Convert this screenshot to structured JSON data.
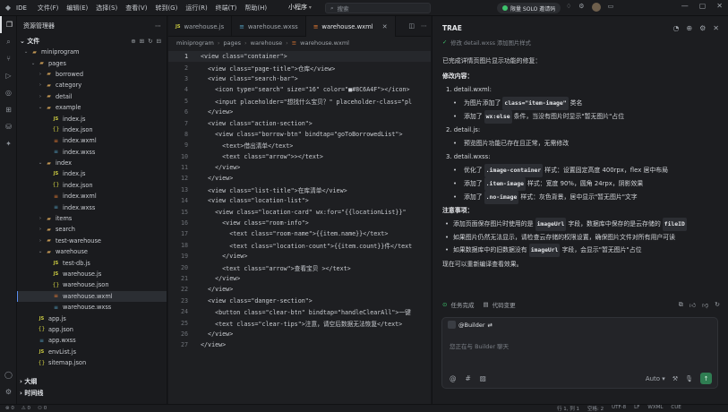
{
  "titlebar": {
    "ide": "IDE",
    "menu": [
      "文件(F)",
      "编辑(E)",
      "选择(S)",
      "查看(V)",
      "转到(G)",
      "运行(R)",
      "终端(T)",
      "帮助(H)"
    ],
    "project": "小程序",
    "search_placeholder": "搜索",
    "solo_label": "限量 SOLO 邀请码"
  },
  "explorer": {
    "title": "资源管理器",
    "section": "文件",
    "items": [
      {
        "label": "miniprogram",
        "depth": 0,
        "type": "folder",
        "open": true
      },
      {
        "label": "pages",
        "depth": 1,
        "type": "folder",
        "open": true
      },
      {
        "label": "borrowed",
        "depth": 2,
        "type": "folder",
        "open": false
      },
      {
        "label": "category",
        "depth": 2,
        "type": "folder",
        "open": false
      },
      {
        "label": "detail",
        "depth": 2,
        "type": "folder",
        "open": false
      },
      {
        "label": "example",
        "depth": 2,
        "type": "folder",
        "open": true
      },
      {
        "label": "index.js",
        "depth": 3,
        "type": "js"
      },
      {
        "label": "index.json",
        "depth": 3,
        "type": "json"
      },
      {
        "label": "index.wxml",
        "depth": 3,
        "type": "wxml"
      },
      {
        "label": "index.wxss",
        "depth": 3,
        "type": "wxss"
      },
      {
        "label": "index",
        "depth": 2,
        "type": "folder",
        "open": true
      },
      {
        "label": "index.js",
        "depth": 3,
        "type": "js"
      },
      {
        "label": "index.json",
        "depth": 3,
        "type": "json"
      },
      {
        "label": "index.wxml",
        "depth": 3,
        "type": "wxml"
      },
      {
        "label": "index.wxss",
        "depth": 3,
        "type": "wxss"
      },
      {
        "label": "items",
        "depth": 2,
        "type": "folder",
        "open": false
      },
      {
        "label": "search",
        "depth": 2,
        "type": "folder",
        "open": false
      },
      {
        "label": "test-warehouse",
        "depth": 2,
        "type": "folder",
        "open": false
      },
      {
        "label": "warehouse",
        "depth": 2,
        "type": "folder",
        "open": true
      },
      {
        "label": "test-db.js",
        "depth": 3,
        "type": "js"
      },
      {
        "label": "warehouse.js",
        "depth": 3,
        "type": "js"
      },
      {
        "label": "warehouse.json",
        "depth": 3,
        "type": "json"
      },
      {
        "label": "warehouse.wxml",
        "depth": 3,
        "type": "wxml",
        "selected": true
      },
      {
        "label": "warehouse.wxss",
        "depth": 3,
        "type": "wxss"
      },
      {
        "label": "app.js",
        "depth": 1,
        "type": "js"
      },
      {
        "label": "app.json",
        "depth": 1,
        "type": "json"
      },
      {
        "label": "app.wxss",
        "depth": 1,
        "type": "wxss"
      },
      {
        "label": "envList.js",
        "depth": 1,
        "type": "js"
      },
      {
        "label": "sitemap.json",
        "depth": 1,
        "type": "json"
      }
    ],
    "outline": "大纲",
    "timeline": "时间线"
  },
  "editor": {
    "tabs": [
      {
        "label": "warehouse.js",
        "type": "js",
        "active": false
      },
      {
        "label": "warehouse.wxss",
        "type": "wxss",
        "active": false
      },
      {
        "label": "warehouse.wxml",
        "type": "wxml",
        "active": true
      }
    ],
    "breadcrumb": [
      "miniprogram",
      "pages",
      "warehouse",
      "warehouse.wxml"
    ],
    "current_line": 1,
    "lines": [
      "<view class=\"container\">",
      "  <view class=\"page-title\">仓库</view>",
      "  <view class=\"search-bar\">",
      "    <icon type=\"search\" size=\"16\" color=\"■#8C6A4F\"></icon>",
      "    <input placeholder=\"想找什么宝贝？\" placeholder-class=\"pl",
      "  </view>",
      "  <view class=\"action-section\">",
      "    <view class=\"borrow-btn\" bindtap=\"goToBorrowedList\">",
      "      <text>借出清单</text>",
      "      <text class=\"arrow\">></text>",
      "    </view>",
      "  </view>",
      "  <view class=\"list-title\">在库清单</view>",
      "  <view class=\"location-list\">",
      "    <view class=\"location-card\" wx:for=\"{{locationList}}\"",
      "      <view class=\"room-info\">",
      "        <text class=\"room-name\">{{item.name}}</text>",
      "        <text class=\"location-count\">{{item.count}}件</text",
      "      </view>",
      "      <text class=\"arrow\">查看宝贝 ></text>",
      "    </view>",
      "  </view>",
      "  <view class=\"danger-section\">",
      "    <button class=\"clear-btn\" bindtap=\"handleClearAll\">一键",
      "    <text class=\"clear-tips\">注意，请空后数据无法恢复</text>",
      "  </view>",
      "</view>"
    ]
  },
  "chat": {
    "title": "TRAE",
    "prev_task": "修改 detail.wxss 添加图片样式",
    "intro": "已完成详情页图片显示功能的修复：",
    "changes_heading": "修改内容：",
    "changes": [
      {
        "file": "1. detail.wxml:",
        "subs": [
          [
            "为图片添加了",
            "class=\"item-image\"",
            "类名"
          ],
          [
            "添加了",
            "wx:else",
            "条件，当没有图片时显示\"暂无图片\"占位"
          ]
        ]
      },
      {
        "file": "2. detail.js:",
        "subs": [
          [
            "预览图片功能已存在且正常，无需修改",
            "",
            ""
          ]
        ]
      },
      {
        "file": "3. detail.wxss:",
        "subs": [
          [
            "优化了",
            ".image-container",
            "样式：设置固定高度 400rpx，flex 居中布局"
          ],
          [
            "添加了",
            ".item-image",
            "样式：宽度 90%，圆角 24rpx，阴影效果"
          ],
          [
            "添加了",
            ".no-image",
            "样式：灰色背景，居中显示\"暂无图片\"文字"
          ]
        ]
      }
    ],
    "notes_heading": "注意事项：",
    "notes": [
      [
        "添加页面保存图片时使用的是",
        "imageUrl",
        "字段，数据库中保存的是云存储的",
        "fileID"
      ],
      [
        "如果图片仍然无法显示，请检查云存储的权限设置，确保图片文件对所有用户可读",
        "",
        "",
        ""
      ],
      [
        "如果数据库中的旧数据没有",
        "imageUrl",
        "字段，会显示\"暂无图片\"占位",
        ""
      ]
    ],
    "closing": "现在可以重新编译查看效果。",
    "status_done": "任务完成",
    "status_changes": "代码变更",
    "input_tag": "@Builder",
    "input_placeholder": "您正在与 Builder 聊天",
    "mode": "Auto"
  },
  "statusbar": {
    "left": [
      "⊗ 0",
      "⚠ 0",
      "⚇ 0"
    ],
    "right": [
      "行 1, 列 1",
      "空格: 2",
      "UTF-8",
      "LF",
      "WXML",
      "CUE"
    ]
  }
}
